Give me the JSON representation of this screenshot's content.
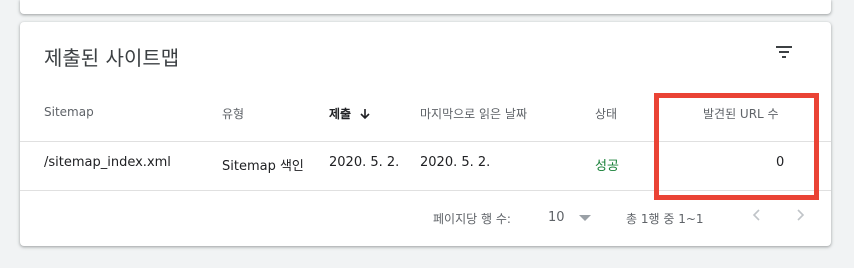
{
  "card": {
    "title": "제출된 사이트맵",
    "filter_icon": "filter-icon"
  },
  "table": {
    "headers": {
      "sitemap": "Sitemap",
      "type": "유형",
      "submitted": "제출",
      "last_read": "마지막으로 읽은 날짜",
      "status": "상태",
      "discovered_urls": "발견된 URL 수"
    },
    "sort_icon": "arrow-down-icon",
    "rows": [
      {
        "sitemap": "/sitemap_index.xml",
        "type": "Sitemap 색인",
        "submitted": "2020. 5. 2.",
        "last_read": "2020. 5. 2.",
        "status": "성공",
        "discovered_urls": "0"
      }
    ]
  },
  "pagination": {
    "rows_per_page_label": "페이지당 행 수:",
    "rows_per_page_value": "10",
    "range_text": "총 1행 중 1~1",
    "prev_icon": "chevron-left-icon",
    "next_icon": "chevron-right-icon"
  },
  "colors": {
    "success": "#188038",
    "highlight": "#ea4335"
  }
}
